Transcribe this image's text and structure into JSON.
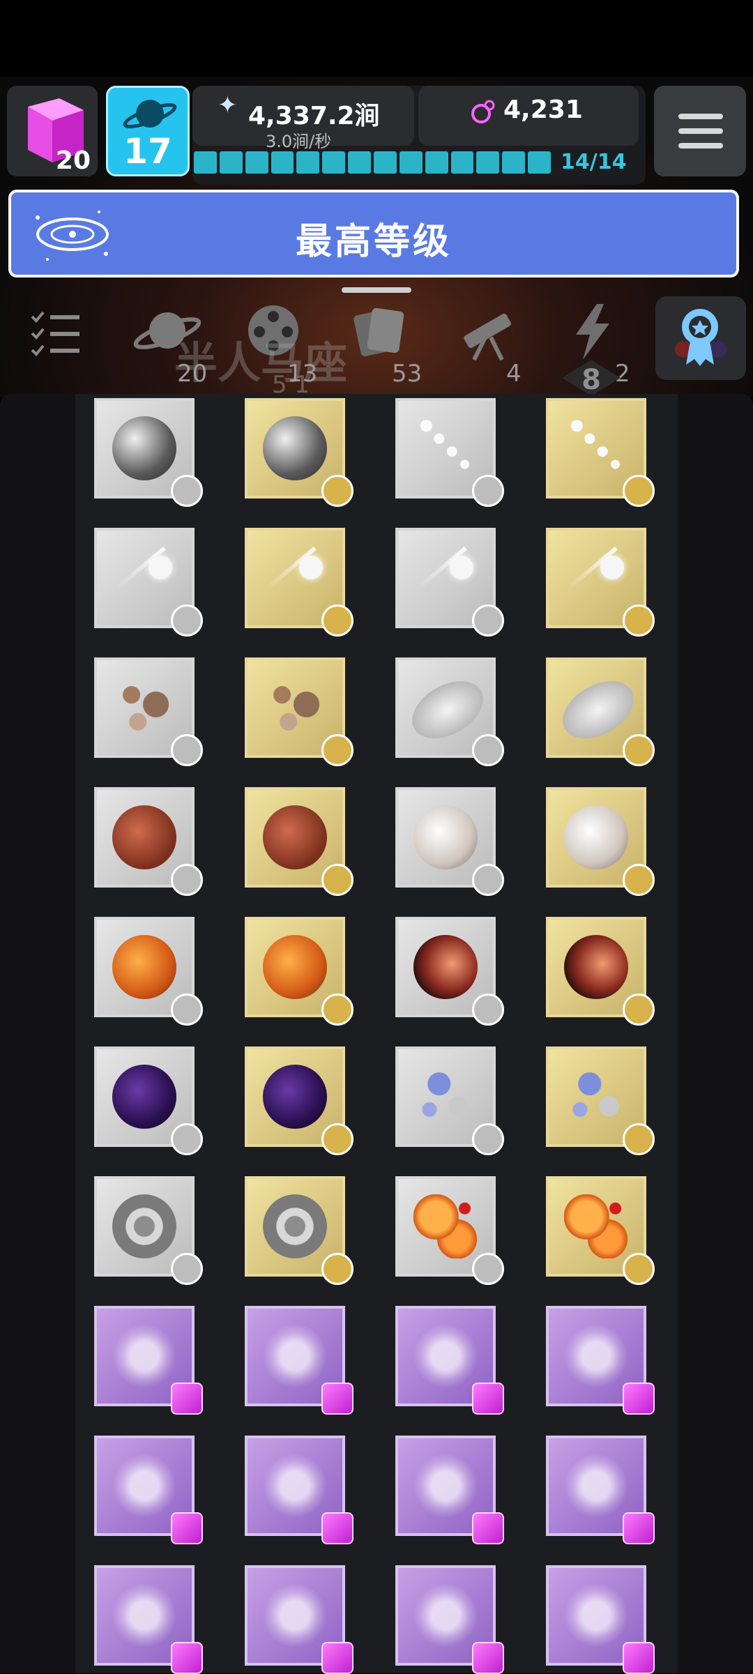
{
  "header": {
    "cube_count": "20",
    "level": "17",
    "resource1": {
      "value": "4,337.2涧",
      "rate": "3.0涧/秒"
    },
    "resource2": {
      "value": "4,231"
    },
    "progress": {
      "label": "14/14",
      "fraction": 1.0,
      "segments": 14
    }
  },
  "banner": {
    "title": "最高等级"
  },
  "tabs": [
    {
      "icon": "checklist-icon",
      "count": ""
    },
    {
      "icon": "planet-icon",
      "count": "20"
    },
    {
      "icon": "film-reel-icon",
      "count": "13"
    },
    {
      "icon": "cards-icon",
      "count": "53"
    },
    {
      "icon": "telescope-icon",
      "count": "4"
    },
    {
      "icon": "lightning-icon",
      "count": "2"
    },
    {
      "icon": "award-ribbon-icon",
      "count": ""
    }
  ],
  "tab_overlay": {
    "text1": "半人马座",
    "text2": "5 1",
    "diamond": "8"
  },
  "grid": [
    [
      "grey",
      "grey",
      "dots",
      "dots"
    ],
    [
      "comet",
      "comet",
      "comet",
      "comet"
    ],
    [
      "rocks",
      "rocks",
      "oval",
      "oval"
    ],
    [
      "red",
      "red",
      "white",
      "white"
    ],
    [
      "lava",
      "lava",
      "nebula",
      "nebula"
    ],
    [
      "black",
      "black",
      "crystals",
      "crystals"
    ],
    [
      "ring",
      "ring",
      "binary",
      "binary"
    ],
    [
      "constel",
      "constel",
      "constel",
      "constel"
    ],
    [
      "constel",
      "constel",
      "constel",
      "constel"
    ],
    [
      "constel",
      "constel",
      "constel",
      "constel"
    ]
  ]
}
